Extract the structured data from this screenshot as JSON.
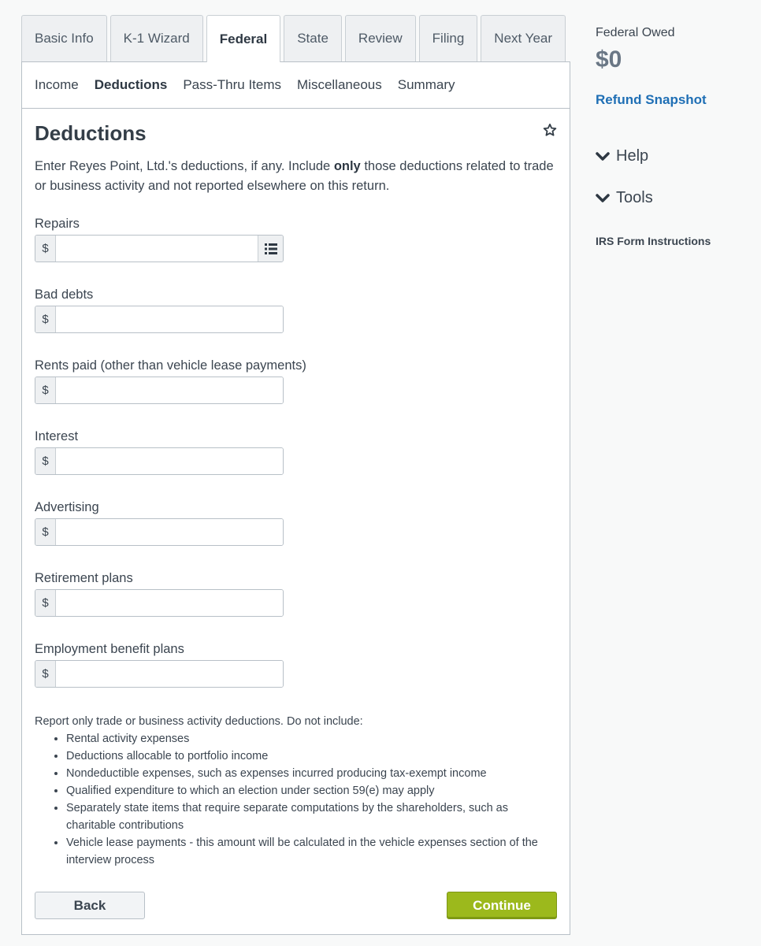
{
  "tabs": [
    {
      "label": "Basic Info",
      "active": false
    },
    {
      "label": "K-1 Wizard",
      "active": false
    },
    {
      "label": "Federal",
      "active": true
    },
    {
      "label": "State",
      "active": false
    },
    {
      "label": "Review",
      "active": false
    },
    {
      "label": "Filing",
      "active": false
    },
    {
      "label": "Next Year",
      "active": false
    }
  ],
  "subnav": [
    {
      "label": "Income",
      "active": false
    },
    {
      "label": "Deductions",
      "active": true
    },
    {
      "label": "Pass-Thru Items",
      "active": false
    },
    {
      "label": "Miscellaneous",
      "active": false
    },
    {
      "label": "Summary",
      "active": false
    }
  ],
  "page": {
    "title": "Deductions",
    "intro_before": "Enter Reyes Point, Ltd.'s deductions, if any. Include ",
    "intro_bold": "only",
    "intro_after": " those deductions related to trade or business activity and not reported elsewhere on this return."
  },
  "fields": [
    {
      "label": "Repairs",
      "currency": "$",
      "value": "",
      "has_list_button": true
    },
    {
      "label": "Bad debts",
      "currency": "$",
      "value": ""
    },
    {
      "label": "Rents paid (other than vehicle lease payments)",
      "currency": "$",
      "value": ""
    },
    {
      "label": "Interest",
      "currency": "$",
      "value": ""
    },
    {
      "label": "Advertising",
      "currency": "$",
      "value": ""
    },
    {
      "label": "Retirement plans",
      "currency": "$",
      "value": ""
    },
    {
      "label": "Employment benefit plans",
      "currency": "$",
      "value": ""
    }
  ],
  "note": {
    "heading": "Report only trade or business activity deductions. Do not include:",
    "items": [
      "Rental activity expenses",
      "Deductions allocable to portfolio income",
      "Nondeductible expenses, such as expenses incurred producing tax-exempt income",
      "Qualified expenditure to which an election under section 59(e) may apply",
      "Separately state items that require separate computations by the shareholders, such as charitable contributions",
      "Vehicle lease payments - this amount will be calculated in the vehicle expenses section of the interview process"
    ]
  },
  "buttons": {
    "back": "Back",
    "continue": "Continue"
  },
  "sidebar": {
    "owed_label": "Federal Owed",
    "owed_value": "$0",
    "refund_link": "Refund Snapshot",
    "help": "Help",
    "tools": "Tools",
    "irs_link": "IRS Form Instructions"
  },
  "colors": {
    "accent_green": "#9cb91c",
    "link_blue": "#1f6fb5"
  }
}
